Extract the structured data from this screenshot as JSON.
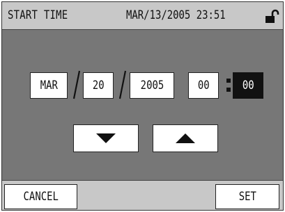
{
  "header": {
    "title": "START TIME",
    "current_datetime": "MAR/13/2005 23:51",
    "lock_icon": "unlocked-padlock-icon"
  },
  "editor": {
    "month": "MAR",
    "day": "20",
    "year": "2005",
    "hour": "00",
    "minute": "00",
    "selected_field": "minute"
  },
  "controls": {
    "down_icon": "triangle-down-icon",
    "up_icon": "triangle-up-icon"
  },
  "footer": {
    "cancel_label": "CANCEL",
    "set_label": "SET"
  },
  "colors": {
    "header_bg": "#c8c8c8",
    "panel_bg": "#777777",
    "field_bg": "#ffffff",
    "selected_bg": "#111111"
  }
}
